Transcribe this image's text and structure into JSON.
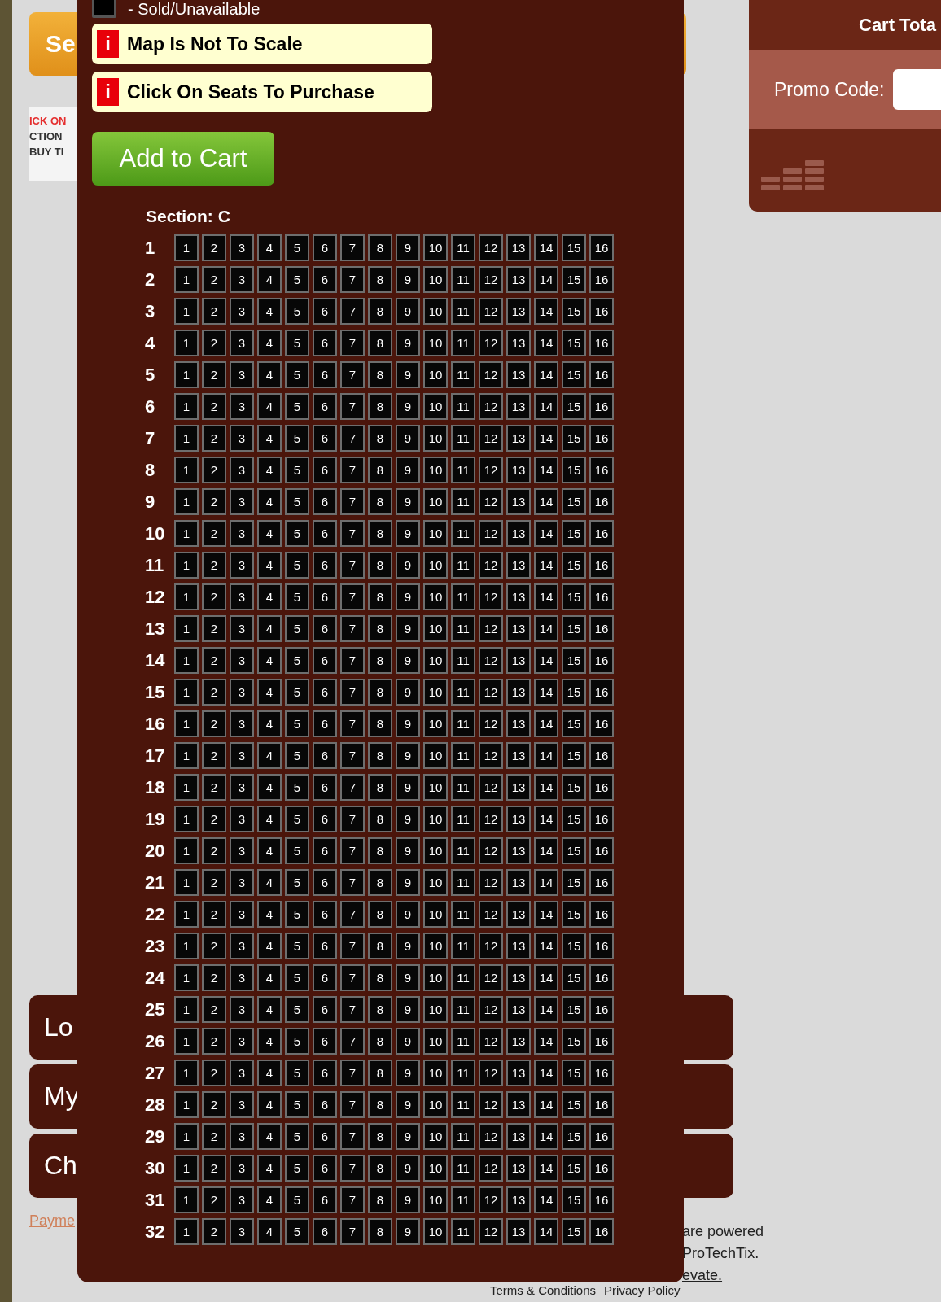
{
  "page": {
    "top_button": "Se",
    "banner_lines": [
      "ICK ON",
      "CTION",
      "BUY TI"
    ],
    "menu_buttons": [
      "Lo",
      "My",
      "Ch"
    ],
    "payment_link": "Payme",
    "footer": {
      "lines": [
        "are powered",
        "ProTechTix."
      ],
      "link": "evate.",
      "bottom_links": [
        "Terms & Conditions",
        "Privacy Policy"
      ]
    }
  },
  "cart": {
    "title": "Cart Tota",
    "promo_label": "Promo Code:"
  },
  "seat_map": {
    "legend": {
      "label": "- Sold/Unavailable"
    },
    "notices": [
      {
        "icon": "i",
        "text": "Map Is Not To Scale"
      },
      {
        "icon": "i",
        "text": "Click On Seats To Purchase"
      }
    ],
    "add_button": "Add to Cart",
    "section": "Section: C",
    "rows": [
      {
        "label": "1",
        "sold": true,
        "seats": [
          "1",
          "2",
          "3",
          "4",
          "5",
          "6",
          "7",
          "8",
          "9",
          "10",
          "11",
          "12",
          "13",
          "14",
          "15",
          "16"
        ]
      },
      {
        "label": "2",
        "sold": true,
        "seats": [
          "1",
          "2",
          "3",
          "4",
          "5",
          "6",
          "7",
          "8",
          "9",
          "10",
          "11",
          "12",
          "13",
          "14",
          "15",
          "16"
        ]
      },
      {
        "label": "3",
        "sold": true,
        "seats": [
          "1",
          "2",
          "3",
          "4",
          "5",
          "6",
          "7",
          "8",
          "9",
          "10",
          "11",
          "12",
          "13",
          "14",
          "15",
          "16"
        ]
      },
      {
        "label": "4",
        "sold": true,
        "seats": [
          "1",
          "2",
          "3",
          "4",
          "5",
          "6",
          "7",
          "8",
          "9",
          "10",
          "11",
          "12",
          "13",
          "14",
          "15",
          "16"
        ]
      },
      {
        "label": "5",
        "sold": true,
        "seats": [
          "1",
          "2",
          "3",
          "4",
          "5",
          "6",
          "7",
          "8",
          "9",
          "10",
          "11",
          "12",
          "13",
          "14",
          "15",
          "16"
        ]
      },
      {
        "label": "6",
        "sold": true,
        "seats": [
          "1",
          "2",
          "3",
          "4",
          "5",
          "6",
          "7",
          "8",
          "9",
          "10",
          "11",
          "12",
          "13",
          "14",
          "15",
          "16"
        ]
      },
      {
        "label": "7",
        "sold": true,
        "seats": [
          "1",
          "2",
          "3",
          "4",
          "5",
          "6",
          "7",
          "8",
          "9",
          "10",
          "11",
          "12",
          "13",
          "14",
          "15",
          "16"
        ]
      },
      {
        "label": "8",
        "sold": true,
        "seats": [
          "1",
          "2",
          "3",
          "4",
          "5",
          "6",
          "7",
          "8",
          "9",
          "10",
          "11",
          "12",
          "13",
          "14",
          "15",
          "16"
        ]
      },
      {
        "label": "9",
        "sold": true,
        "seats": [
          "1",
          "2",
          "3",
          "4",
          "5",
          "6",
          "7",
          "8",
          "9",
          "10",
          "11",
          "12",
          "13",
          "14",
          "15",
          "16"
        ]
      },
      {
        "label": "10",
        "sold": true,
        "seats": [
          "1",
          "2",
          "3",
          "4",
          "5",
          "6",
          "7",
          "8",
          "9",
          "10",
          "11",
          "12",
          "13",
          "14",
          "15",
          "16"
        ]
      },
      {
        "label": "11",
        "sold": true,
        "seats": [
          "1",
          "2",
          "3",
          "4",
          "5",
          "6",
          "7",
          "8",
          "9",
          "10",
          "11",
          "12",
          "13",
          "14",
          "15",
          "16"
        ]
      },
      {
        "label": "12",
        "sold": true,
        "seats": [
          "1",
          "2",
          "3",
          "4",
          "5",
          "6",
          "7",
          "8",
          "9",
          "10",
          "11",
          "12",
          "13",
          "14",
          "15",
          "16"
        ]
      },
      {
        "label": "13",
        "sold": true,
        "seats": [
          "1",
          "2",
          "3",
          "4",
          "5",
          "6",
          "7",
          "8",
          "9",
          "10",
          "11",
          "12",
          "13",
          "14",
          "15",
          "16"
        ]
      },
      {
        "label": "14",
        "sold": true,
        "seats": [
          "1",
          "2",
          "3",
          "4",
          "5",
          "6",
          "7",
          "8",
          "9",
          "10",
          "11",
          "12",
          "13",
          "14",
          "15",
          "16"
        ]
      },
      {
        "label": "15",
        "sold": true,
        "seats": [
          "1",
          "2",
          "3",
          "4",
          "5",
          "6",
          "7",
          "8",
          "9",
          "10",
          "11",
          "12",
          "13",
          "14",
          "15",
          "16"
        ]
      },
      {
        "label": "16",
        "sold": true,
        "seats": [
          "1",
          "2",
          "3",
          "4",
          "5",
          "6",
          "7",
          "8",
          "9",
          "10",
          "11",
          "12",
          "13",
          "14",
          "15",
          "16"
        ]
      },
      {
        "label": "17",
        "sold": true,
        "seats": [
          "1",
          "2",
          "3",
          "4",
          "5",
          "6",
          "7",
          "8",
          "9",
          "10",
          "11",
          "12",
          "13",
          "14",
          "15",
          "16"
        ]
      },
      {
        "label": "18",
        "sold": true,
        "seats": [
          "1",
          "2",
          "3",
          "4",
          "5",
          "6",
          "7",
          "8",
          "9",
          "10",
          "11",
          "12",
          "13",
          "14",
          "15",
          "16"
        ]
      },
      {
        "label": "19",
        "sold": true,
        "seats": [
          "1",
          "2",
          "3",
          "4",
          "5",
          "6",
          "7",
          "8",
          "9",
          "10",
          "11",
          "12",
          "13",
          "14",
          "15",
          "16"
        ]
      },
      {
        "label": "20",
        "sold": true,
        "seats": [
          "1",
          "2",
          "3",
          "4",
          "5",
          "6",
          "7",
          "8",
          "9",
          "10",
          "11",
          "12",
          "13",
          "14",
          "15",
          "16"
        ]
      },
      {
        "label": "21",
        "sold": true,
        "seats": [
          "1",
          "2",
          "3",
          "4",
          "5",
          "6",
          "7",
          "8",
          "9",
          "10",
          "11",
          "12",
          "13",
          "14",
          "15",
          "16"
        ]
      },
      {
        "label": "22",
        "sold": true,
        "seats": [
          "1",
          "2",
          "3",
          "4",
          "5",
          "6",
          "7",
          "8",
          "9",
          "10",
          "11",
          "12",
          "13",
          "14",
          "15",
          "16"
        ]
      },
      {
        "label": "23",
        "sold": true,
        "seats": [
          "1",
          "2",
          "3",
          "4",
          "5",
          "6",
          "7",
          "8",
          "9",
          "10",
          "11",
          "12",
          "13",
          "14",
          "15",
          "16"
        ]
      },
      {
        "label": "24",
        "sold": true,
        "seats": [
          "1",
          "2",
          "3",
          "4",
          "5",
          "6",
          "7",
          "8",
          "9",
          "10",
          "11",
          "12",
          "13",
          "14",
          "15",
          "16"
        ]
      },
      {
        "label": "25",
        "sold": true,
        "seats": [
          "1",
          "2",
          "3",
          "4",
          "5",
          "6",
          "7",
          "8",
          "9",
          "10",
          "11",
          "12",
          "13",
          "14",
          "15",
          "16"
        ]
      },
      {
        "label": "26",
        "sold": true,
        "seats": [
          "1",
          "2",
          "3",
          "4",
          "5",
          "6",
          "7",
          "8",
          "9",
          "10",
          "11",
          "12",
          "13",
          "14",
          "15",
          "16"
        ]
      },
      {
        "label": "27",
        "sold": true,
        "seats": [
          "1",
          "2",
          "3",
          "4",
          "5",
          "6",
          "7",
          "8",
          "9",
          "10",
          "11",
          "12",
          "13",
          "14",
          "15",
          "16"
        ]
      },
      {
        "label": "28",
        "sold": true,
        "seats": [
          "1",
          "2",
          "3",
          "4",
          "5",
          "6",
          "7",
          "8",
          "9",
          "10",
          "11",
          "12",
          "13",
          "14",
          "15",
          "16"
        ]
      },
      {
        "label": "29",
        "sold": true,
        "seats": [
          "1",
          "2",
          "3",
          "4",
          "5",
          "6",
          "7",
          "8",
          "9",
          "10",
          "11",
          "12",
          "13",
          "14",
          "15",
          "16"
        ]
      },
      {
        "label": "30",
        "sold": true,
        "seats": [
          "1",
          "2",
          "3",
          "4",
          "5",
          "6",
          "7",
          "8",
          "9",
          "10",
          "11",
          "12",
          "13",
          "14",
          "15",
          "16"
        ]
      },
      {
        "label": "31",
        "sold": true,
        "seats": [
          "1",
          "2",
          "3",
          "4",
          "5",
          "6",
          "7",
          "8",
          "9",
          "10",
          "11",
          "12",
          "13",
          "14",
          "15",
          "16"
        ]
      },
      {
        "label": "32",
        "sold": true,
        "seats": [
          "1",
          "2",
          "3",
          "4",
          "5",
          "6",
          "7",
          "8",
          "9",
          "10",
          "11",
          "12",
          "13",
          "14",
          "15",
          "16"
        ]
      }
    ]
  }
}
